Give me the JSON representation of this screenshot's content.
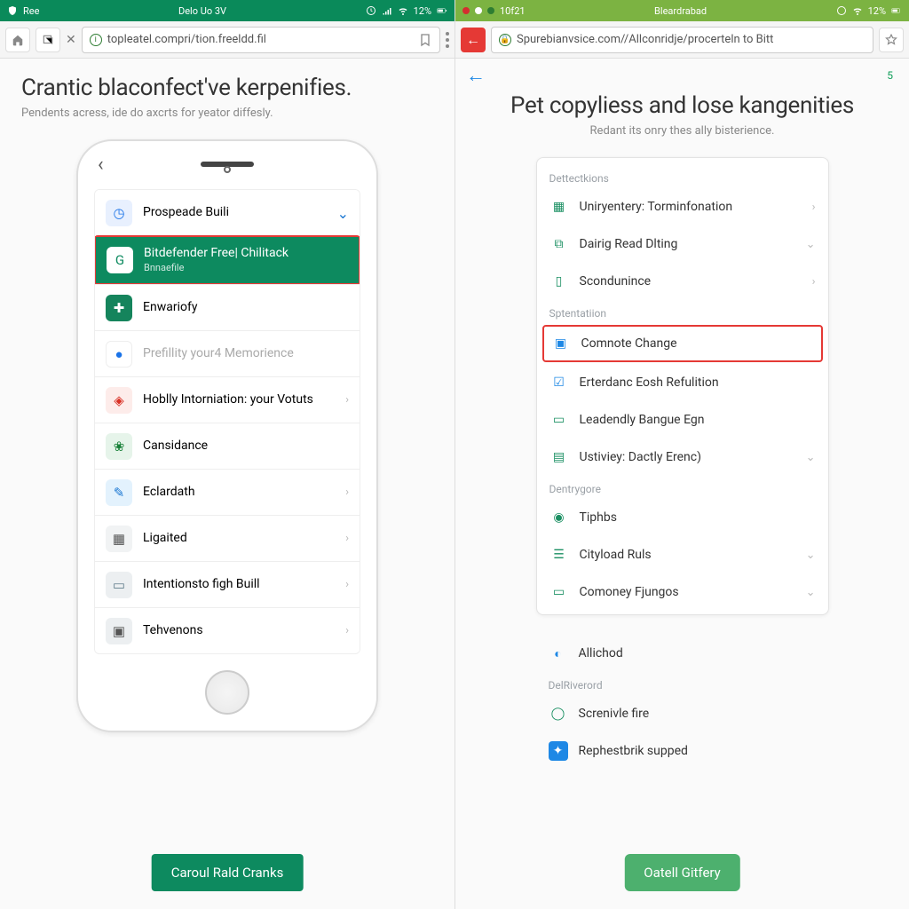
{
  "left": {
    "status": {
      "app": "Ree",
      "center": "Delo Uo 3V",
      "battery": "12%"
    },
    "url": "topleatel.compri/tion.freeldd.fil",
    "title": "Crantic blaconfect've kerpenifies.",
    "subtitle": "Pendents acress, ide do axcrts for yeator diffesly.",
    "phone": {
      "back": "‹",
      "header": {
        "title": "Prospeade Buili",
        "chev": "⌄"
      },
      "active": {
        "title": "Bitdefender Free| Chilitack",
        "sub": "Bnnaefile"
      },
      "items": [
        {
          "icon": "enwar",
          "title": "Enwariofy"
        },
        {
          "icon": "pref",
          "title": "Prefillity your4 Memorience",
          "muted": true
        },
        {
          "icon": "hob",
          "title": "Hoblly Intorniation: your Votuts",
          "chev": "›"
        },
        {
          "icon": "cans",
          "title": "Cansidance"
        },
        {
          "icon": "ecl",
          "title": "Eclardath",
          "chev": "›"
        },
        {
          "icon": "lig",
          "title": "Ligaited",
          "chev": "›"
        },
        {
          "icon": "int",
          "title": "Intentionsto figh Buill",
          "chev": "›"
        },
        {
          "icon": "teh",
          "title": "Tehvenons",
          "chev": "›"
        }
      ]
    },
    "cta": "Caroul Rald Cranks"
  },
  "right": {
    "status": {
      "center": "Bleardrabad",
      "battery": "12%",
      "app": "10f21"
    },
    "url": "Spurebianvsice.com//Allconridje/procerteln to Bitt",
    "back": "←",
    "corner": "5",
    "title": "Pet copyliess and lose kangenities",
    "subtitle": "Redant its onry thes ally bisterience.",
    "sections": {
      "detect": {
        "label": "Dettectkions",
        "rows": [
          {
            "icon": "cal",
            "title": "Uniryentery: Torminfonation",
            "chev": "›"
          },
          {
            "icon": "copy",
            "title": "Dairig Read Dlting",
            "chev": "⌄"
          },
          {
            "icon": "doc",
            "title": "Scondunince",
            "chev": "›"
          }
        ]
      },
      "sprat": {
        "label": "Sptentatiion",
        "rows": [
          {
            "icon": "book",
            "title": "Comnote Change",
            "hl": true
          },
          {
            "icon": "check",
            "title": "Erterdanc Eosh Refulition"
          },
          {
            "icon": "lead",
            "title": "Leadendly Bangue Egn"
          },
          {
            "icon": "ust",
            "title": "Ustiviey: Dactly Erenc)",
            "chev": "⌄"
          }
        ]
      },
      "dent": {
        "label": "Dentrygore",
        "rows": [
          {
            "icon": "pin",
            "title": "Tiphbs"
          },
          {
            "icon": "list",
            "title": "Cityload Ruls",
            "chev": "⌄"
          },
          {
            "icon": "lap",
            "title": "Comoney Fjungos",
            "chev": "⌄"
          }
        ]
      }
    },
    "loose": [
      {
        "icon": "globe",
        "title": "Allichod"
      }
    ],
    "del": {
      "label": "DelRiverord",
      "rows": [
        {
          "icon": "spin",
          "title": "Screnivle fire"
        },
        {
          "icon": "run",
          "title": "Rephestbrik supped"
        }
      ]
    },
    "cta": "Oatell Gitfery"
  }
}
